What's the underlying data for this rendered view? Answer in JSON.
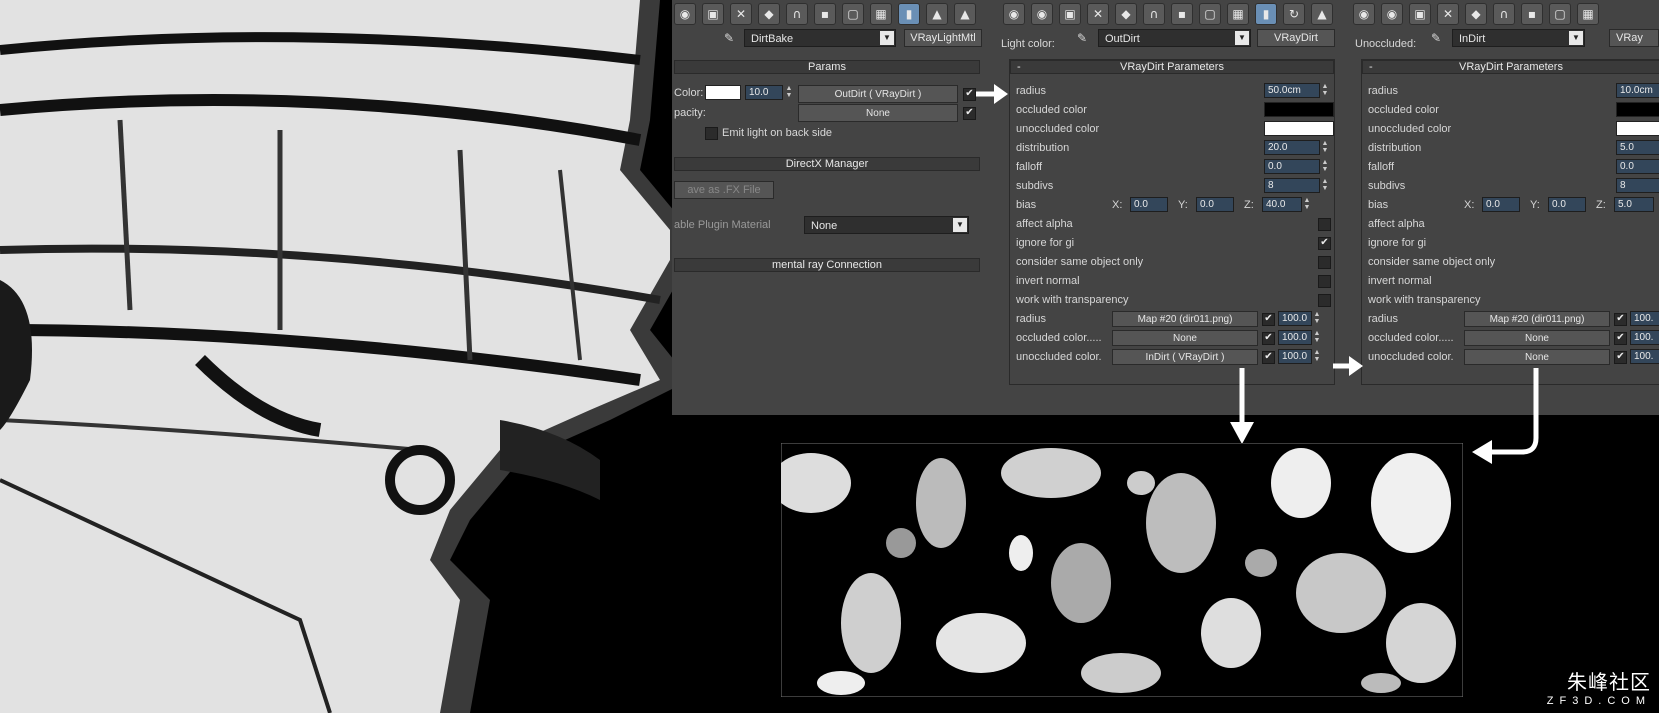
{
  "left_panel": {
    "material_name": "DirtBake",
    "material_type": "VRayLightMtl",
    "params_title": "Params",
    "color_label": "Color:",
    "color_value": "10.0",
    "color_map": "OutDirt  ( VRayDirt )",
    "opacity_label": "pacity:",
    "opacity_map": "None",
    "emit_back_label": "Emit light on back side",
    "directx_title": "DirectX Manager",
    "save_fx_label": "ave as .FX File",
    "plugin_label": "able Plugin Material",
    "plugin_value": "None",
    "mental_ray_title": "mental ray Connection"
  },
  "mid_panel": {
    "header_label": "Light color:",
    "map_name": "OutDirt",
    "map_type": "VRayDirt",
    "rollout_title": "VRayDirt Parameters",
    "radius_label": "radius",
    "radius_value": "50.0cm",
    "occluded_label": "occluded color",
    "unoccluded_label": "unoccluded color",
    "distribution_label": "distribution",
    "distribution_value": "20.0",
    "falloff_label": "falloff",
    "falloff_value": "0.0",
    "subdivs_label": "subdivs",
    "subdivs_value": "8",
    "bias_label": "bias",
    "bias_x": "0.0",
    "bias_y": "0.0",
    "bias_z": "40.0",
    "affect_alpha_label": "affect alpha",
    "ignore_gi_label": "ignore for gi",
    "consider_same_label": "consider same object only",
    "invert_normal_label": "invert normal",
    "work_transparency_label": "work with transparency",
    "map_radius_label": "radius",
    "map_radius_value": "Map #20 (dir011.png)",
    "map_radius_amount": "100.0",
    "map_occluded_label": "occluded color.....",
    "map_occluded_value": "None",
    "map_occluded_amount": "100.0",
    "map_unoccluded_label": "unoccluded color.",
    "map_unoccluded_value": "InDirt  ( VRayDirt )",
    "map_unoccluded_amount": "100.0"
  },
  "right_panel": {
    "header_label": "Unoccluded:",
    "map_name": "InDirt",
    "map_type": "VRay",
    "rollout_title": "VRayDirt Parameters",
    "radius_label": "radius",
    "radius_value": "10.0cm",
    "occluded_label": "occluded color",
    "unoccluded_label": "unoccluded color",
    "distribution_label": "distribution",
    "distribution_value": "5.0",
    "falloff_label": "falloff",
    "falloff_value": "0.0",
    "subdivs_label": "subdivs",
    "subdivs_value": "8",
    "bias_label": "bias",
    "bias_x": "0.0",
    "bias_y": "0.0",
    "bias_z": "5.0",
    "affect_alpha_label": "affect alpha",
    "ignore_gi_label": "ignore for gi",
    "consider_same_label": "consider same object only",
    "invert_normal_label": "invert normal",
    "work_transparency_label": "work with transparency",
    "map_radius_label": "radius",
    "map_radius_value": "Map #20 (dir011.png)",
    "map_radius_amount": "100.",
    "map_occluded_label": "occluded color.....",
    "map_occluded_value": "None",
    "map_occluded_amount": "100.",
    "map_unoccluded_label": "unoccluded color.",
    "map_unoccluded_value": "None",
    "map_unoccluded_amount": "100."
  },
  "common": {
    "collapse_glyph": "-",
    "x_label": "X:",
    "y_label": "Y:",
    "z_label": "Z:",
    "check_glyph": "✔",
    "dropdown_glyph": "▼"
  },
  "watermark": {
    "text": "朱峰社区",
    "url": "ZF3D.COM"
  },
  "colors": {
    "ui_bg": "#444444",
    "field_bg": "#33465a",
    "accent": "#6a8fb5"
  }
}
